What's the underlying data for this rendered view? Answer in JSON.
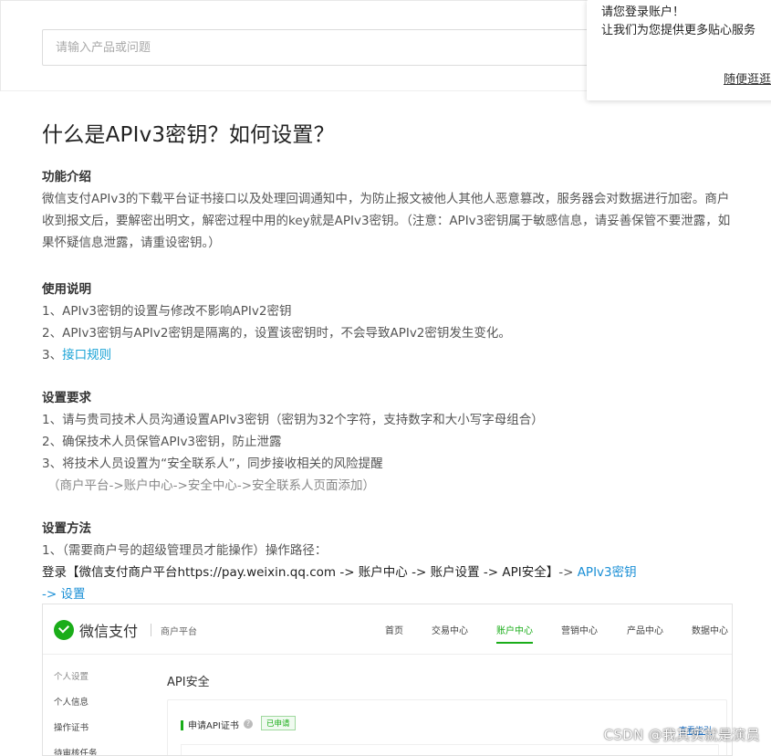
{
  "search": {
    "placeholder": "请输入产品或问题"
  },
  "login_popup": {
    "line1": "请您登录账户！",
    "line2": "让我们为您提供更多贴心服务",
    "later": "随便逛逛"
  },
  "article": {
    "title": "什么是APIv3密钥？如何设置？",
    "intro": {
      "heading": "功能介绍",
      "text": "微信支付APIv3的下载平台证书接口以及处理回调通知中，为防止报文被他人其他人恶意篡改，服务器会对数据进行加密。商户收到报文后，要解密出明文，解密过程中用的key就是APIv3密钥。（注意：APIv3密钥属于敏感信息，请妥善保管不要泄露，如果怀疑信息泄露，请重设密钥。）"
    },
    "usage": {
      "heading": "使用说明",
      "item1": "1、APIv3密钥的设置与修改不影响APIv2密钥",
      "item2": "2、APIv3密钥与APIv2密钥是隔离的，设置该密钥时，不会导致APIv2密钥发生变化。",
      "item3_prefix": "3、",
      "item3_link": "接口规则"
    },
    "requirements": {
      "heading": "设置要求",
      "item1": "1、请与贵司技术人员沟通设置APIv3密钥（密钥为32个字符，支持数字和大小写字母组合）",
      "item2": "2、确保技术人员保管APIv3密钥，防止泄露",
      "item3": "3、将技术人员设置为“安全联系人”，同步接收相关的风险提醒",
      "note": "（商户平台->账户中心->安全中心->安全联系人页面添加）"
    },
    "method": {
      "heading": "设置方法",
      "step1": "1、（需要商户号的超级管理员才能操作）操作路径：",
      "path_dark": "登录【微信支付商户平台https://pay.weixin.qq.com ->  账户中心 ->  账户设置 ->  API安全】",
      "path_arrow": "->  ",
      "path_blue1": "APIv3密钥",
      "path_blue2": "-> 设置"
    }
  },
  "screenshot": {
    "brand": "微信支付",
    "sub": "商户平台",
    "nav": [
      "首页",
      "交易中心",
      "账户中心",
      "营销中心",
      "产品中心",
      "数据中心"
    ],
    "active_nav": "账户中心",
    "side": [
      "个人设置",
      "个人信息",
      "操作证书",
      "待审核任务"
    ],
    "page_title": "API安全",
    "panel_title": "申请API证书",
    "help": "?",
    "badge": "已申请",
    "guide": "查看指引"
  },
  "watermark": "CSDN @我其实就是演员",
  "colors": {
    "wechat_green": "#1aad19",
    "link_blue": "#1aa3d6"
  }
}
